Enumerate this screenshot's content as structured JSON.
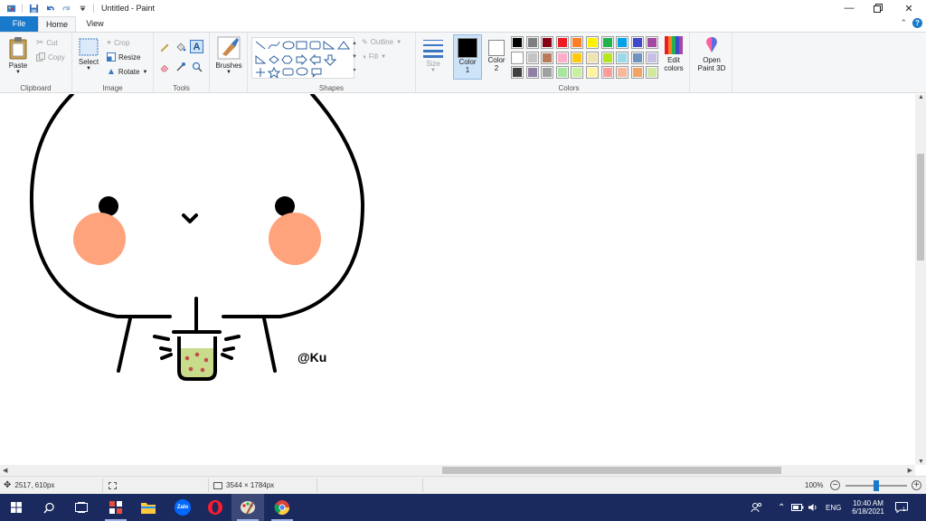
{
  "window": {
    "title": "Untitled - Paint",
    "controls": [
      "minimize-icon",
      "restore-icon",
      "close-icon"
    ]
  },
  "tabs": [
    {
      "label": "File"
    },
    {
      "label": "Home"
    },
    {
      "label": "View"
    }
  ],
  "ribbon": {
    "clipboard": {
      "label": "Clipboard",
      "paste": "Paste",
      "cut": "Cut",
      "copy": "Copy"
    },
    "image": {
      "label": "Image",
      "select": "Select",
      "crop": "Crop",
      "resize": "Resize",
      "rotate": "Rotate"
    },
    "tools": {
      "label": "Tools"
    },
    "brushes": {
      "label": "Brushes"
    },
    "shapes": {
      "label": "Shapes",
      "outline": "Outline",
      "fill": "Fill"
    },
    "size": {
      "label": "Size"
    },
    "colors": {
      "label": "Colors",
      "color1_label": "Color",
      "color1_num": "1",
      "color2_label": "Color",
      "color2_num": "2",
      "color1_value": "#000000",
      "color2_value": "#ffffff",
      "edit_colors_1": "Edit",
      "edit_colors_2": "colors",
      "open_3d_1": "Open",
      "open_3d_2": "Paint 3D",
      "palette": [
        "#000000",
        "#7f7f7f",
        "#880015",
        "#ed1c24",
        "#ff7f27",
        "#fff200",
        "#22b14c",
        "#00a2e8",
        "#3f48cc",
        "#a349a4",
        "#ffffff",
        "#c3c3c3",
        "#b97a57",
        "#ffaec9",
        "#ffc90e",
        "#efe4b0",
        "#b5e61d",
        "#99d9ea",
        "#7092be",
        "#c8bfe7",
        "#404040",
        "#8e7fa3",
        "#a0a0a0",
        "#a8e6a0",
        "#c8f0a0",
        "#fff5a0",
        "#ff9c9c",
        "#f8b89c",
        "#f4a460",
        "#d0e8a0"
      ]
    }
  },
  "canvas": {
    "signature": "@Ku",
    "colors": {
      "outline": "#000000",
      "cheek": "#fea37b",
      "drink": "#c8dc8c",
      "boba": "#c0504d"
    }
  },
  "statusbar": {
    "cursor_pos": "2517, 610px",
    "image_size": "3544 × 1784px",
    "zoom": "100%",
    "zoom_level": 0.5
  },
  "taskbar": {
    "apps": [
      "start-icon",
      "search-icon",
      "task-view-icon",
      "app-icon",
      "file-explorer-icon",
      "zalo-icon",
      "opera-icon",
      "paint-icon",
      "chrome-icon"
    ],
    "zalo_label": "Zalo",
    "lang": "ENG",
    "time": "10:40 AM",
    "date": "6/18/2021",
    "notif_count": "1"
  }
}
